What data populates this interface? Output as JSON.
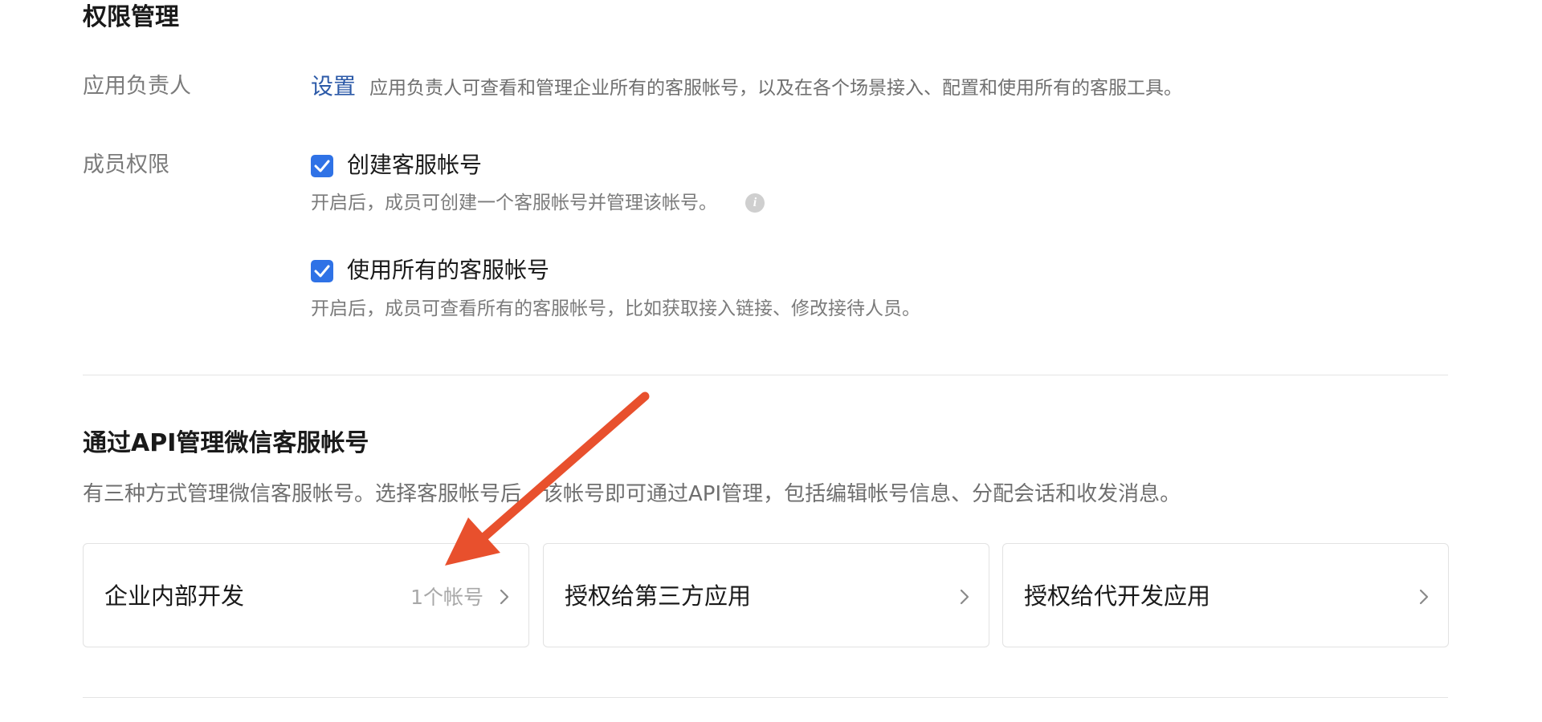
{
  "permissions": {
    "title": "权限管理",
    "owner": {
      "label": "应用负责人",
      "link": "设置",
      "description": "应用负责人可查看和管理企业所有的客服帐号，以及在各个场景接入、配置和使用所有的客服工具。"
    },
    "member": {
      "label": "成员权限",
      "options": [
        {
          "label": "创建客服帐号",
          "checked": true,
          "hint": "开启后，成员可创建一个客服帐号并管理该帐号。"
        },
        {
          "label": "使用所有的客服帐号",
          "checked": true,
          "hint": "开启后，成员可查看所有的客服帐号，比如获取接入链接、修改接待人员。"
        }
      ]
    }
  },
  "api": {
    "title": "通过API管理微信客服帐号",
    "description": "有三种方式管理微信客服帐号。选择客服帐号后，该帐号即可通过API管理，包括编辑帐号信息、分配会话和收发消息。",
    "cards": [
      {
        "title": "企业内部开发",
        "count": "1个帐号"
      },
      {
        "title": "授权给第三方应用",
        "count": ""
      },
      {
        "title": "授权给代开发应用",
        "count": ""
      }
    ]
  },
  "colors": {
    "accent": "#2f72e6",
    "link": "#2c5aa8",
    "annotation_arrow": "#e8502d"
  },
  "icons": {
    "checkbox": "check-icon",
    "info": "info-icon",
    "card_chevron": "chevron-right-icon"
  }
}
